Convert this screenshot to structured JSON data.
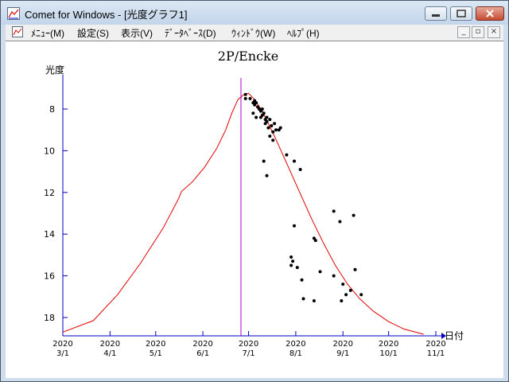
{
  "window": {
    "title": "Comet for Windows - [光度グラフ1]",
    "icon": "graph-app-icon"
  },
  "menu": {
    "items": [
      "ﾒﾆｭｰ(M)",
      "設定(S)",
      "表示(V)",
      "ﾃﾞｰﾀﾍﾞｰｽ(D)",
      "ｳｨﾝﾄﾞｳ(W)",
      "ﾍﾙﾌﾟ(H)"
    ]
  },
  "chart_data": {
    "type": "scatter",
    "title": "2P/Encke",
    "ylabel": "光度",
    "xlabel": "日付",
    "y_inverted": true,
    "ylim": [
      18.8,
      6.8
    ],
    "yticks": [
      8,
      10,
      12,
      14,
      16,
      18
    ],
    "xlim": [
      "2020-03-01",
      "2020-11-01"
    ],
    "xticks": [
      {
        "year": "2020",
        "date": "3/1"
      },
      {
        "year": "2020",
        "date": "4/1"
      },
      {
        "year": "2020",
        "date": "5/1"
      },
      {
        "year": "2020",
        "date": "6/1"
      },
      {
        "year": "2020",
        "date": "7/1"
      },
      {
        "year": "2020",
        "date": "8/1"
      },
      {
        "year": "2020",
        "date": "9/1"
      },
      {
        "year": "2020",
        "date": "10/1"
      },
      {
        "year": "2020",
        "date": "11/1"
      }
    ],
    "vertical_marker": "2020-06-26",
    "colors": {
      "curve": "#e00000",
      "marker": "#b000d0",
      "axis": "#0000c0",
      "points": "#000000"
    },
    "series": [
      {
        "kind": "predicted-curve",
        "points": [
          [
            "2020-03-01",
            18.7
          ],
          [
            "2020-03-21",
            18.15
          ],
          [
            "2020-04-06",
            16.9
          ],
          [
            "2020-04-21",
            15.4
          ],
          [
            "2020-05-06",
            13.7
          ],
          [
            "2020-05-16",
            12.3
          ],
          [
            "2020-05-18",
            11.95
          ],
          [
            "2020-05-25",
            11.5
          ],
          [
            "2020-06-02",
            10.8
          ],
          [
            "2020-06-10",
            9.9
          ],
          [
            "2020-06-16",
            9.0
          ],
          [
            "2020-06-20",
            8.2
          ],
          [
            "2020-06-24",
            7.55
          ],
          [
            "2020-06-28",
            7.3
          ],
          [
            "2020-07-01",
            7.25
          ],
          [
            "2020-07-05",
            7.55
          ],
          [
            "2020-07-10",
            8.1
          ],
          [
            "2020-07-18",
            9.3
          ],
          [
            "2020-07-26",
            10.6
          ],
          [
            "2020-08-03",
            11.9
          ],
          [
            "2020-08-11",
            13.2
          ],
          [
            "2020-08-19",
            14.4
          ],
          [
            "2020-08-27",
            15.5
          ],
          [
            "2020-09-04",
            16.4
          ],
          [
            "2020-09-12",
            17.1
          ],
          [
            "2020-09-21",
            17.7
          ],
          [
            "2020-10-01",
            18.2
          ],
          [
            "2020-10-11",
            18.55
          ],
          [
            "2020-10-24",
            18.8
          ]
        ]
      },
      {
        "kind": "observations",
        "points": [
          [
            "2020-06-29",
            7.3
          ],
          [
            "2020-06-29",
            7.5
          ],
          [
            "2020-07-02",
            7.5
          ],
          [
            "2020-07-04",
            7.7
          ],
          [
            "2020-07-05",
            7.6
          ],
          [
            "2020-07-05",
            7.8
          ],
          [
            "2020-07-06",
            7.7
          ],
          [
            "2020-07-07",
            7.9
          ],
          [
            "2020-07-08",
            8.0
          ],
          [
            "2020-07-09",
            8.1
          ],
          [
            "2020-07-09",
            8.4
          ],
          [
            "2020-07-10",
            8.0
          ],
          [
            "2020-07-10",
            8.3
          ],
          [
            "2020-07-11",
            8.2
          ],
          [
            "2020-07-12",
            8.5
          ],
          [
            "2020-07-12",
            8.7
          ],
          [
            "2020-07-13",
            8.4
          ],
          [
            "2020-07-13",
            8.6
          ],
          [
            "2020-07-14",
            8.9
          ],
          [
            "2020-07-15",
            8.5
          ],
          [
            "2020-07-16",
            8.8
          ],
          [
            "2020-07-17",
            9.1
          ],
          [
            "2020-07-17",
            9.5
          ],
          [
            "2020-07-18",
            8.7
          ],
          [
            "2020-07-19",
            9.0
          ],
          [
            "2020-07-21",
            9.0
          ],
          [
            "2020-07-22",
            8.9
          ],
          [
            "2020-07-04",
            8.2
          ],
          [
            "2020-07-06",
            8.4
          ],
          [
            "2020-07-15",
            9.3
          ],
          [
            "2020-07-11",
            10.5
          ],
          [
            "2020-07-13",
            11.2
          ],
          [
            "2020-07-26",
            10.2
          ],
          [
            "2020-07-31",
            10.5
          ],
          [
            "2020-08-04",
            10.9
          ],
          [
            "2020-07-31",
            13.6
          ],
          [
            "2020-07-29",
            15.1
          ],
          [
            "2020-07-30",
            15.3
          ],
          [
            "2020-07-29",
            15.5
          ],
          [
            "2020-08-02",
            15.6
          ],
          [
            "2020-08-05",
            16.2
          ],
          [
            "2020-08-06",
            17.1
          ],
          [
            "2020-08-13",
            17.2
          ],
          [
            "2020-08-13",
            14.2
          ],
          [
            "2020-08-14",
            14.3
          ],
          [
            "2020-08-17",
            15.8
          ],
          [
            "2020-08-26",
            16.0
          ],
          [
            "2020-08-26",
            12.9
          ],
          [
            "2020-08-30",
            13.4
          ],
          [
            "2020-09-08",
            13.1
          ],
          [
            "2020-09-01",
            16.4
          ],
          [
            "2020-09-03",
            16.9
          ],
          [
            "2020-09-06",
            16.7
          ],
          [
            "2020-09-09",
            15.7
          ],
          [
            "2020-09-13",
            16.9
          ],
          [
            "2020-08-31",
            17.2
          ]
        ]
      }
    ]
  }
}
